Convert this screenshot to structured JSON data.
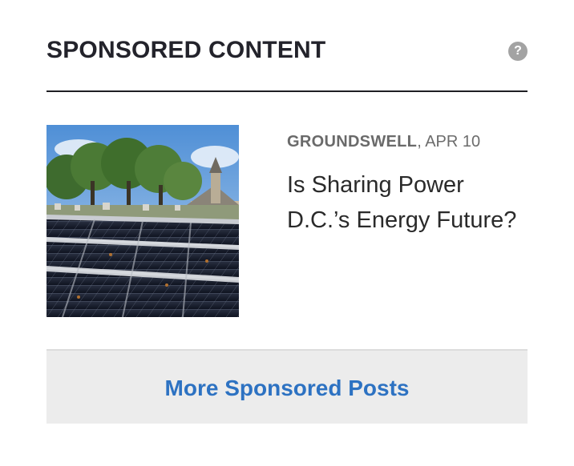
{
  "widget": {
    "title": "SPONSORED CONTENT",
    "help_symbol": "?"
  },
  "story": {
    "source": "GROUNDSWELL",
    "separator": ", ",
    "date": "APR 10",
    "headline": "Is Sharing Power D.C.’s Energy Future?",
    "image_subject": "solar-panels-church"
  },
  "footer": {
    "more_label": "More Sponsored Posts",
    "link_color": "#2d72c2"
  },
  "colors": {
    "rule": "#1f1f24",
    "footer_bg": "#ececec",
    "help_icon_bg": "#a3a3a3"
  }
}
